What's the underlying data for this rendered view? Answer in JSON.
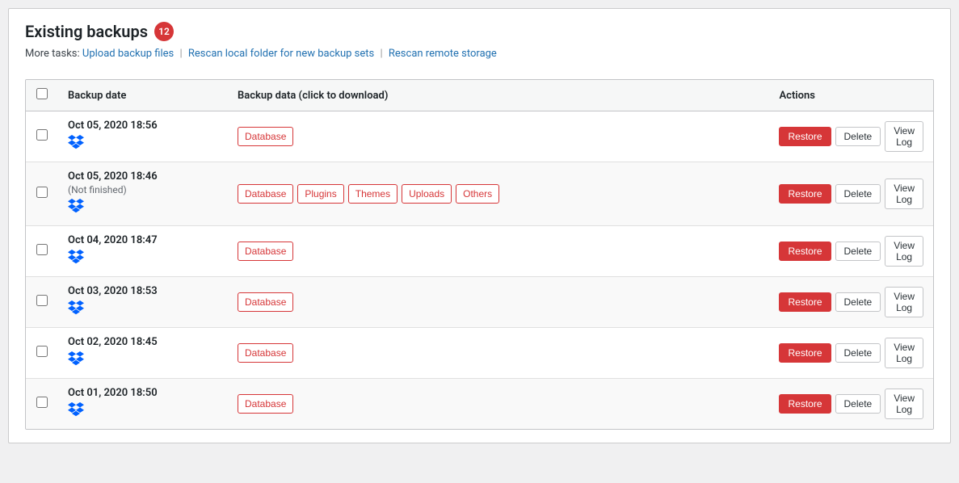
{
  "header": {
    "title": "Existing backups",
    "badge": "12",
    "more_tasks_label": "More tasks:",
    "links": [
      {
        "label": "Upload backup files",
        "href": "#"
      },
      {
        "label": "Rescan local folder for new backup sets",
        "href": "#"
      },
      {
        "label": "Rescan remote storage",
        "href": "#"
      }
    ]
  },
  "table": {
    "columns": [
      "",
      "Backup date",
      "Backup data (click to download)",
      "Actions"
    ],
    "rows": [
      {
        "date": "Oct 05, 2020 18:56",
        "sub": "",
        "has_dropbox": true,
        "tags": [
          "Database"
        ],
        "actions": [
          "Restore",
          "Delete",
          "View Log"
        ]
      },
      {
        "date": "Oct 05, 2020 18:46",
        "sub": "(Not finished)",
        "has_dropbox": true,
        "tags": [
          "Database",
          "Plugins",
          "Themes",
          "Uploads",
          "Others"
        ],
        "actions": [
          "Restore",
          "Delete",
          "View Log"
        ]
      },
      {
        "date": "Oct 04, 2020 18:47",
        "sub": "",
        "has_dropbox": true,
        "tags": [
          "Database"
        ],
        "actions": [
          "Restore",
          "Delete",
          "View Log"
        ]
      },
      {
        "date": "Oct 03, 2020 18:53",
        "sub": "",
        "has_dropbox": true,
        "tags": [
          "Database"
        ],
        "actions": [
          "Restore",
          "Delete",
          "View Log"
        ]
      },
      {
        "date": "Oct 02, 2020 18:45",
        "sub": "",
        "has_dropbox": true,
        "tags": [
          "Database"
        ],
        "actions": [
          "Restore",
          "Delete",
          "View Log"
        ]
      },
      {
        "date": "Oct 01, 2020 18:50",
        "sub": "",
        "has_dropbox": true,
        "tags": [
          "Database"
        ],
        "actions": [
          "Restore",
          "Delete",
          "View Log"
        ]
      }
    ]
  },
  "dropbox_symbol": "✿",
  "colors": {
    "restore_bg": "#d63638",
    "tag_border": "#d63638",
    "link": "#2271b1"
  }
}
